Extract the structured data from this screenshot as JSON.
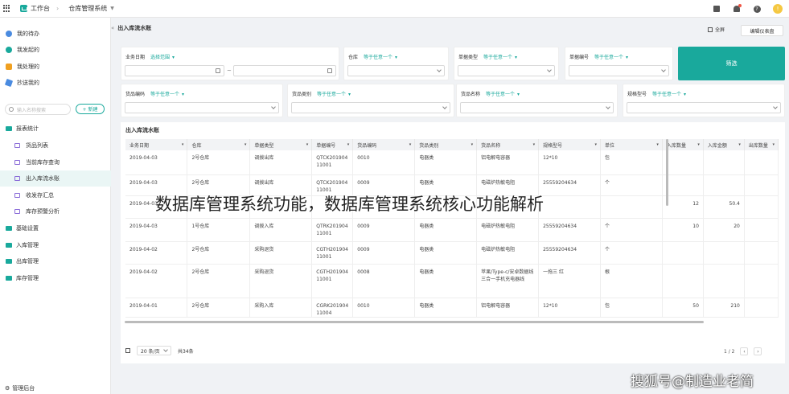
{
  "topbar": {
    "workspace": "工作台",
    "app": "仓库管理系统",
    "avatar_letter": "!"
  },
  "sidebar": {
    "todo": "我的待办",
    "initiated": "我发起的",
    "handled": "我处理的",
    "cc": "抄送我的",
    "search_placeholder": "输入名称搜索",
    "new_button": "+ 新建",
    "groups": [
      {
        "label": "报表统计"
      },
      {
        "label": "基础设置"
      },
      {
        "label": "入库管理"
      },
      {
        "label": "出库管理"
      },
      {
        "label": "库存管理"
      }
    ],
    "reports": [
      {
        "label": "货品列表"
      },
      {
        "label": "当前库存查询"
      },
      {
        "label": "出入库流水账"
      },
      {
        "label": "收发存汇总"
      },
      {
        "label": "库存预警分析"
      }
    ],
    "admin": "管理后台"
  },
  "header": {
    "breadcrumb": "出入库流水账",
    "fullscreen": "全屏",
    "edit_dashboard": "编辑仪表盘"
  },
  "filters": {
    "date_label": "业务日期",
    "date_op": "选择范围",
    "warehouse_label": "仓库",
    "doc_type_label": "单据类型",
    "doc_no_label": "单据编号",
    "item_code_label": "货品编码",
    "item_cat_label": "货品类别",
    "item_name_label": "货品名称",
    "spec_label": "规格型号",
    "any_op": "等于任意一个",
    "filter_button": "筛选"
  },
  "table": {
    "title": "出入库流水账",
    "columns": [
      "业务日期",
      "仓库",
      "单据类型",
      "单据编号",
      "货品编码",
      "货品类别",
      "货品名称",
      "规格型号",
      "单位",
      "入库数量",
      "入库金额",
      "出库数量"
    ],
    "rows": [
      [
        "2019-04-03",
        "2号仓库",
        "调拨出库",
        "QTCK20190411001",
        "0010",
        "电器类",
        "铝电解电容器",
        "12*10",
        "包",
        "",
        "",
        ""
      ],
      [
        "2019-04-03",
        "2号仓库",
        "调拨出库",
        "QTCK20190411001",
        "0009",
        "电器类",
        "电磁炉热敏电阻",
        "25559204634",
        "个",
        "",
        "",
        ""
      ],
      [
        "2019-04-03",
        "",
        "",
        "",
        "",
        "",
        "",
        "",
        "",
        "12",
        "50.4",
        ""
      ],
      [
        "2019-04-03",
        "1号仓库",
        "调拨入库",
        "QTRK20190411001",
        "0009",
        "电器类",
        "电磁炉热敏电阻",
        "25559204634",
        "个",
        "10",
        "20",
        ""
      ],
      [
        "2019-04-02",
        "2号仓库",
        "采购退货",
        "CGTH20190411001",
        "0009",
        "电器类",
        "电磁炉热敏电阻",
        "25559204634",
        "个",
        "",
        "",
        ""
      ],
      [
        "2019-04-02",
        "2号仓库",
        "采购退货",
        "CGTH20190411001",
        "0008",
        "电器类",
        "苹果/Type-c/安卓数据线三合一手机充电器线",
        "一拖三 红",
        "根",
        "",
        "",
        ""
      ],
      [
        "2019-04-01",
        "2号仓库",
        "采购入库",
        "CGRK20190411004",
        "0010",
        "电器类",
        "铝电解电容器",
        "12*10",
        "包",
        "50",
        "210",
        ""
      ]
    ],
    "page_size": "20 条/页",
    "total": "共34条",
    "page_info": "1 / 2"
  },
  "overlay_title": "数据库管理系统功能，数据库管理系统核心功能解析",
  "watermark": "搜狐号@制造业老简",
  "colors": {
    "accent": "#19a99c"
  }
}
